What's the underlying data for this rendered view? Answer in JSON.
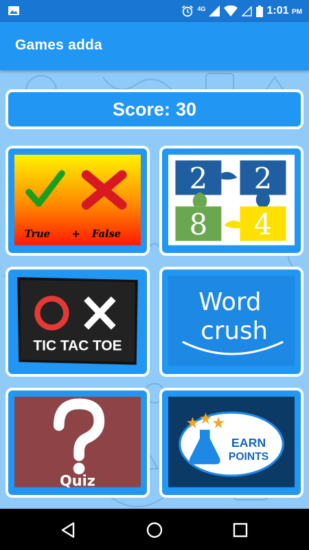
{
  "status_bar": {
    "network": "4G",
    "time": "1:01",
    "ampm": "PM"
  },
  "app": {
    "title": "Games adda"
  },
  "score": {
    "label": "Score:",
    "value": "30"
  },
  "games": [
    {
      "id": "true-false",
      "text1": "True",
      "text2": "+",
      "text3": "False"
    },
    {
      "id": "2248",
      "tiles": [
        "2",
        "2",
        "8",
        "4"
      ]
    },
    {
      "id": "tic-tac-toe",
      "label": "TIC TAC TOE"
    },
    {
      "id": "word-crush",
      "line1": "Word",
      "line2": "crush"
    },
    {
      "id": "quiz",
      "label": "Quiz"
    },
    {
      "id": "earn-points",
      "line1": "EARN",
      "line2": "POINTS"
    }
  ],
  "colors": {
    "status_bar": "#1976d2",
    "app_bar": "#2196f3",
    "background": "#90caf9",
    "tile_frame": "#2196f3"
  },
  "icons": {
    "status_left": "image-icon",
    "alarm": "alarm-icon",
    "wifi": "wifi-icon",
    "signal": "cell-signal-icon",
    "battery": "battery-icon",
    "nav_back": "back-triangle-icon",
    "nav_home": "home-circle-icon",
    "nav_recents": "recents-square-icon"
  }
}
